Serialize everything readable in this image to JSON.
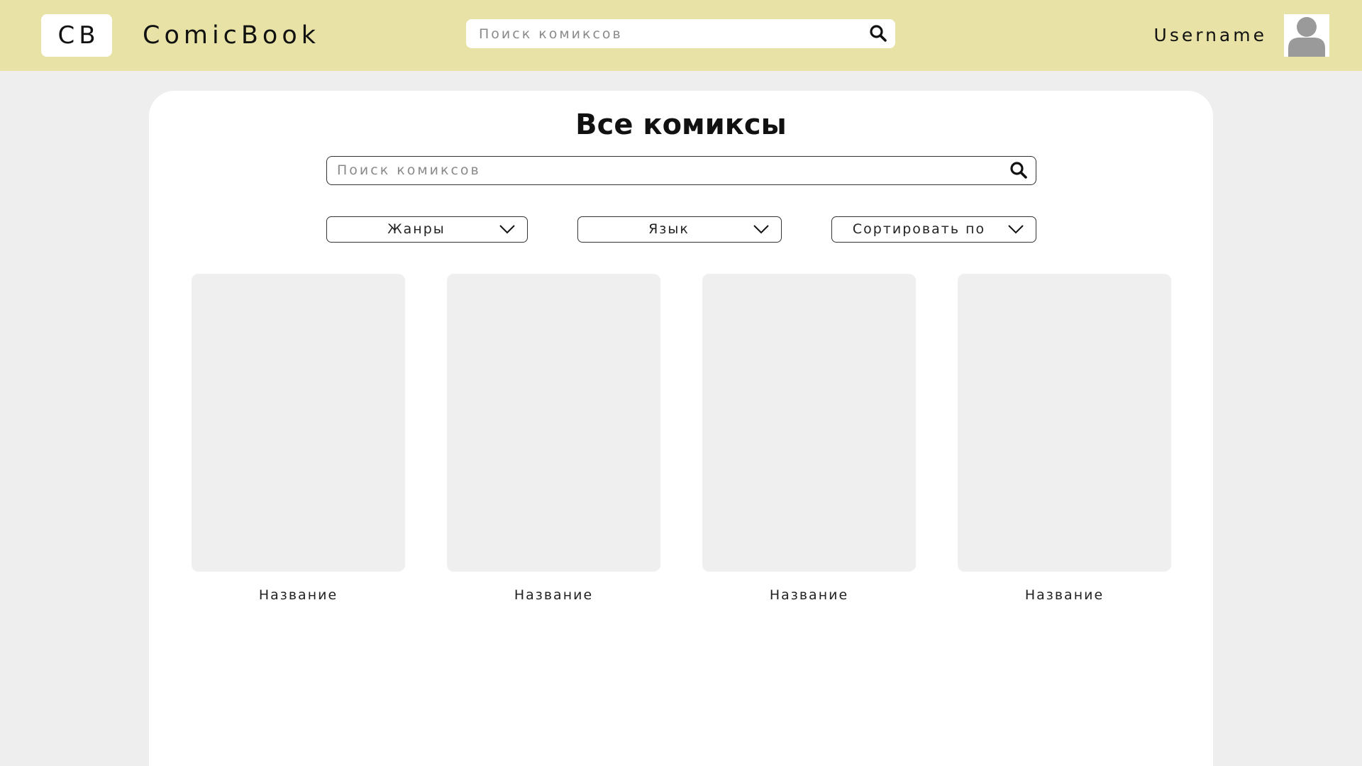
{
  "header": {
    "logo_text": "CB",
    "brand_name": "ComicBook",
    "search_placeholder": "Поиск комиксов",
    "search_icon": "search-icon",
    "username": "Username",
    "avatar_icon": "user-avatar-icon"
  },
  "main": {
    "title": "Все комиксы",
    "search_placeholder": "Поиск комиксов",
    "filters": [
      {
        "label": "Жанры",
        "icon": "chevron-down-icon"
      },
      {
        "label": "Язык",
        "icon": "chevron-down-icon"
      },
      {
        "label": "Сортировать по",
        "icon": "chevron-down-icon"
      }
    ],
    "comics": [
      {
        "title": "Название"
      },
      {
        "title": "Название"
      },
      {
        "title": "Название"
      },
      {
        "title": "Название"
      }
    ]
  },
  "colors": {
    "header_bg": "#e8e2a6",
    "page_bg": "#eeeeee",
    "panel_bg": "#ffffff",
    "cover_placeholder": "#efefef"
  }
}
